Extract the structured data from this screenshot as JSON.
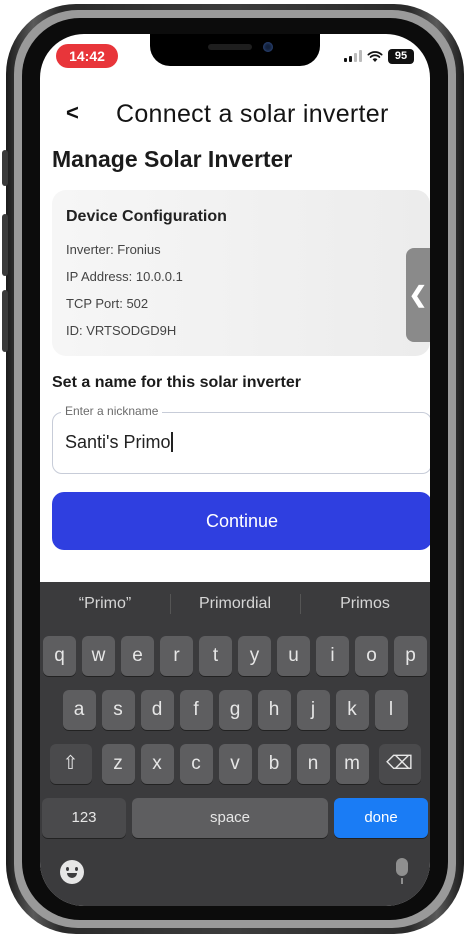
{
  "status": {
    "time": "14:42",
    "battery": "95"
  },
  "nav": {
    "back_glyph": "<",
    "title": "Connect a solar inverter"
  },
  "section_title": "Manage Solar Inverter",
  "device": {
    "title": "Device Configuration",
    "inverter": "Inverter: Fronius",
    "ip": "IP Address: 10.0.0.1",
    "port": "TCP Port: 502",
    "id": "ID: VRTSODGD9H"
  },
  "side_tab_glyph": "❮",
  "nickname": {
    "label": "Set a name for this solar inverter",
    "legend": "Enter a nickname",
    "value": "Santi's Primo"
  },
  "continue_label": "Continue",
  "keyboard": {
    "suggestions": [
      "“Primo”",
      "Primordial",
      "Primos"
    ],
    "row1": [
      "q",
      "w",
      "e",
      "r",
      "t",
      "y",
      "u",
      "i",
      "o",
      "p"
    ],
    "row2": [
      "a",
      "s",
      "d",
      "f",
      "g",
      "h",
      "j",
      "k",
      "l"
    ],
    "row3": [
      "z",
      "x",
      "c",
      "v",
      "b",
      "n",
      "m"
    ],
    "shift_glyph": "⇧",
    "delete_glyph": "⌫",
    "numbers_label": "123",
    "space_label": "space",
    "done_label": "done"
  }
}
